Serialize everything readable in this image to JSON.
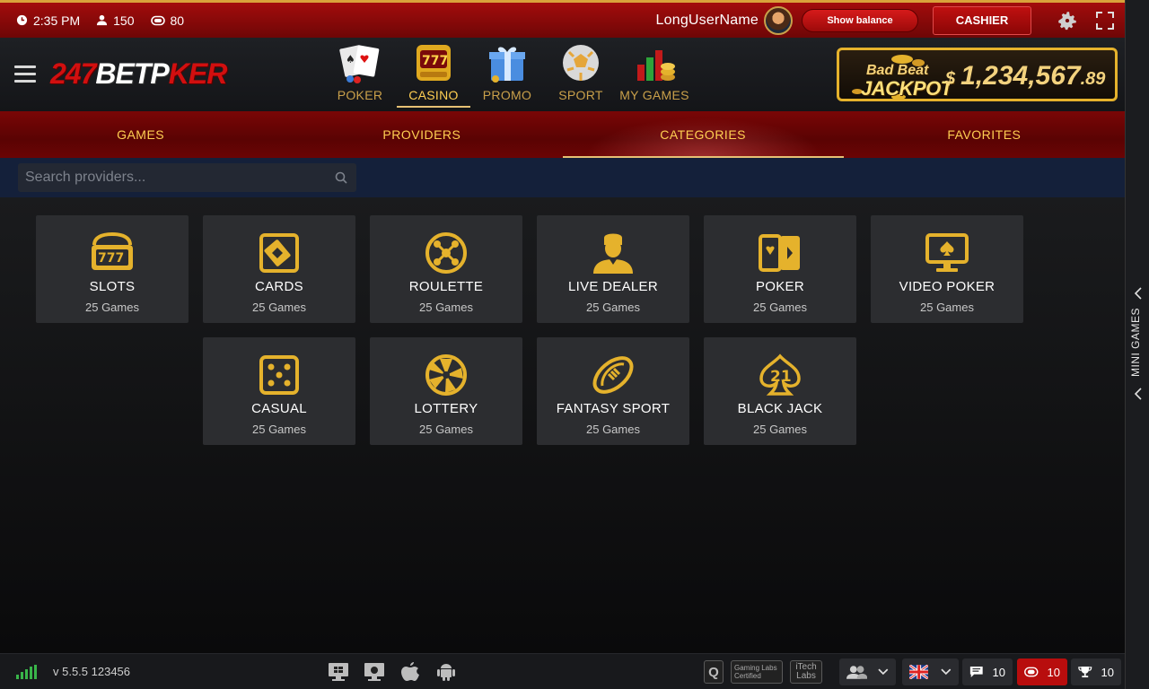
{
  "topbar": {
    "time": "2:35 PM",
    "players": "150",
    "tables": "80",
    "username": "LongUserName",
    "show_balance": "Show balance",
    "cashier": "CASHIER"
  },
  "header": {
    "logo": {
      "part1": "247",
      "part2": "BET",
      "part3": "P",
      "part4": "KER"
    },
    "nav": [
      {
        "label": "POKER",
        "icon": "poker-cards-icon"
      },
      {
        "label": "CASINO",
        "icon": "slot-machine-icon",
        "active": true
      },
      {
        "label": "PROMO",
        "icon": "gift-box-icon"
      },
      {
        "label": "SPORT",
        "icon": "soccer-ball-icon"
      },
      {
        "label": "MY GAMES",
        "icon": "chart-coins-icon"
      }
    ],
    "jackpot": {
      "line1": "Bad Beat",
      "line2": "JACKPOT",
      "currency": "$",
      "amount": "1,234,567",
      "cents": ".89"
    }
  },
  "tabs": [
    {
      "label": "GAMES"
    },
    {
      "label": "PROVIDERS"
    },
    {
      "label": "CATEGORIES",
      "active": true
    },
    {
      "label": "FAVORITES"
    }
  ],
  "search": {
    "placeholder": "Search providers..."
  },
  "categories": [
    {
      "name": "SLOTS",
      "count": "25 Games",
      "icon": "slots-777-icon"
    },
    {
      "name": "CARDS",
      "count": "25 Games",
      "icon": "cards-icon"
    },
    {
      "name": "ROULETTE",
      "count": "25 Games",
      "icon": "roulette-icon"
    },
    {
      "name": "LIVE DEALER",
      "count": "25 Games",
      "icon": "live-dealer-icon"
    },
    {
      "name": "POKER",
      "count": "25 Games",
      "icon": "poker-icon"
    },
    {
      "name": "VIDEO POKER",
      "count": "25 Games",
      "icon": "video-poker-icon"
    },
    {
      "name": "CASUAL",
      "count": "25 Games",
      "icon": "dice-icon"
    },
    {
      "name": "LOTTERY",
      "count": "25 Games",
      "icon": "lottery-icon"
    },
    {
      "name": "FANTASY SPORT",
      "count": "25 Games",
      "icon": "football-icon"
    },
    {
      "name": "BLACK JACK",
      "count": "25 Games",
      "icon": "blackjack-21-icon"
    }
  ],
  "side_panel": {
    "label": "MINI GAMES"
  },
  "footer": {
    "version": "v 5.5.5 123456",
    "cert_q": "Q",
    "cert_gl": "Gaming Labs Certified",
    "cert_itech": "iTech Labs",
    "friends_label": "",
    "chat_count": "10",
    "tables_count": "10",
    "trophy_count": "10"
  },
  "colors": {
    "gold": "#ffcf52",
    "red": "#a30c0c",
    "tile": "#2c2d30"
  }
}
